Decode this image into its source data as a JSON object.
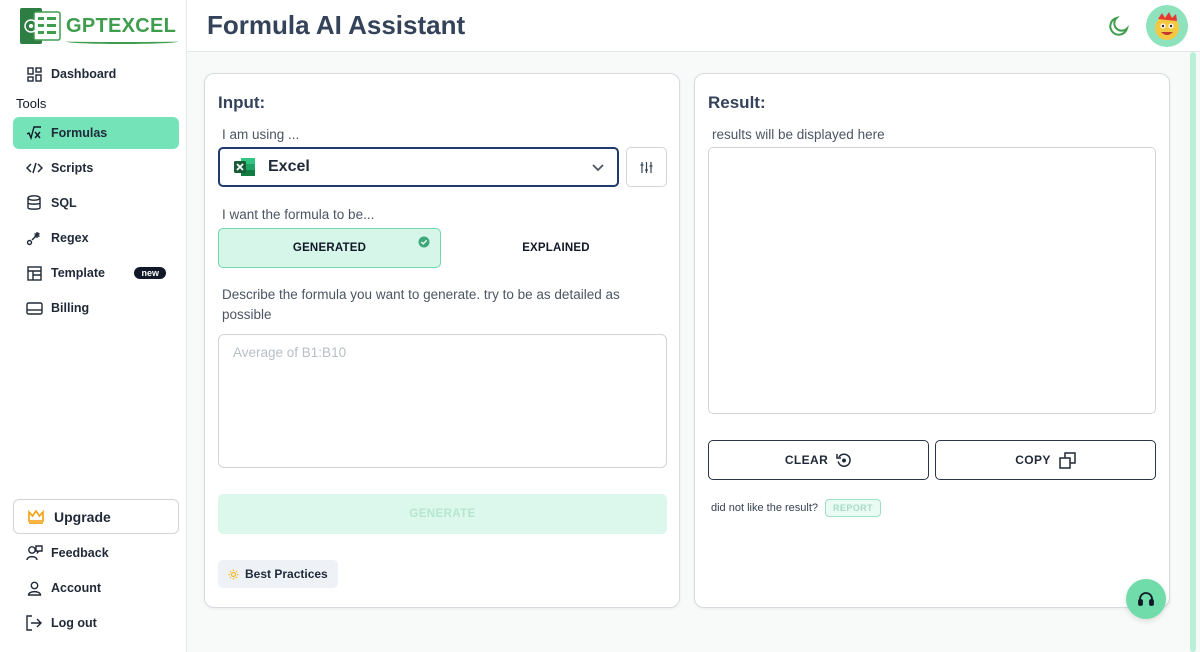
{
  "brand": {
    "name": "GPTEXCEL"
  },
  "sidebar": {
    "dashboard": "Dashboard",
    "tools_label": "Tools",
    "items": [
      {
        "label": "Formulas",
        "icon": "sqrt-icon",
        "active": true
      },
      {
        "label": "Scripts",
        "icon": "code-icon"
      },
      {
        "label": "SQL",
        "icon": "database-icon"
      },
      {
        "label": "Regex",
        "icon": "regex-icon"
      },
      {
        "label": "Template",
        "icon": "template-icon",
        "badge": "new"
      },
      {
        "label": "Billing",
        "icon": "card-icon"
      }
    ],
    "upgrade": "Upgrade",
    "feedback": "Feedback",
    "account": "Account",
    "logout": "Log out"
  },
  "header": {
    "title": "Formula AI Assistant"
  },
  "input_card": {
    "title": "Input:",
    "using_label": "I am using ...",
    "selected_app": "Excel",
    "mode_label": "I want the formula to be...",
    "modes": [
      "GENERATED",
      "EXPLAINED"
    ],
    "active_mode": "GENERATED",
    "describe_label": "Describe the formula you want to generate. try to be as detailed as possible",
    "placeholder": "Average of B1:B10",
    "generate": "GENERATE",
    "best_practices": "Best Practices"
  },
  "result_card": {
    "title": "Result:",
    "hint": "results will be displayed here",
    "clear": "CLEAR",
    "copy": "COPY",
    "feedback_q": "did not like the result?",
    "report": "REPORT"
  },
  "colors": {
    "accent": "#74e4b8",
    "brand_green": "#3f9d4e",
    "title": "#34435a"
  }
}
